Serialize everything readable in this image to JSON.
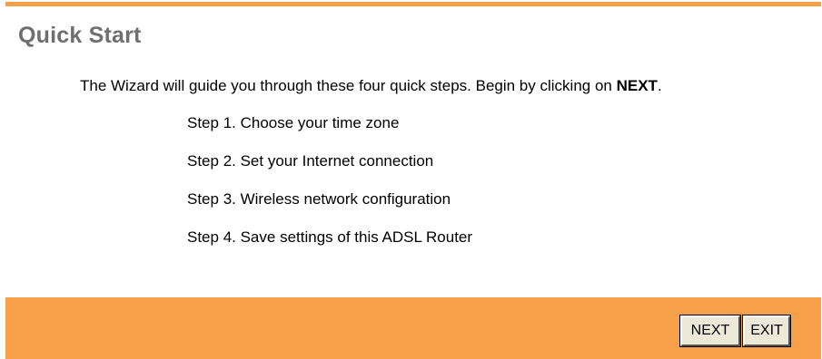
{
  "page": {
    "title": "Quick Start",
    "intro_text": "The Wizard will guide you through these four quick steps. Begin by clicking on ",
    "intro_emphasis": "NEXT",
    "intro_end": "."
  },
  "steps": [
    "Step 1. Choose your time zone",
    "Step 2. Set your Internet connection",
    "Step 3. Wireless network configuration",
    "Step 4. Save settings of this ADSL Router"
  ],
  "buttons": {
    "next_label": "NEXT",
    "exit_label": "EXIT"
  },
  "colors": {
    "accent": "#f7a04a",
    "title": "#6f6f6f",
    "button_face": "#ece9d8"
  }
}
